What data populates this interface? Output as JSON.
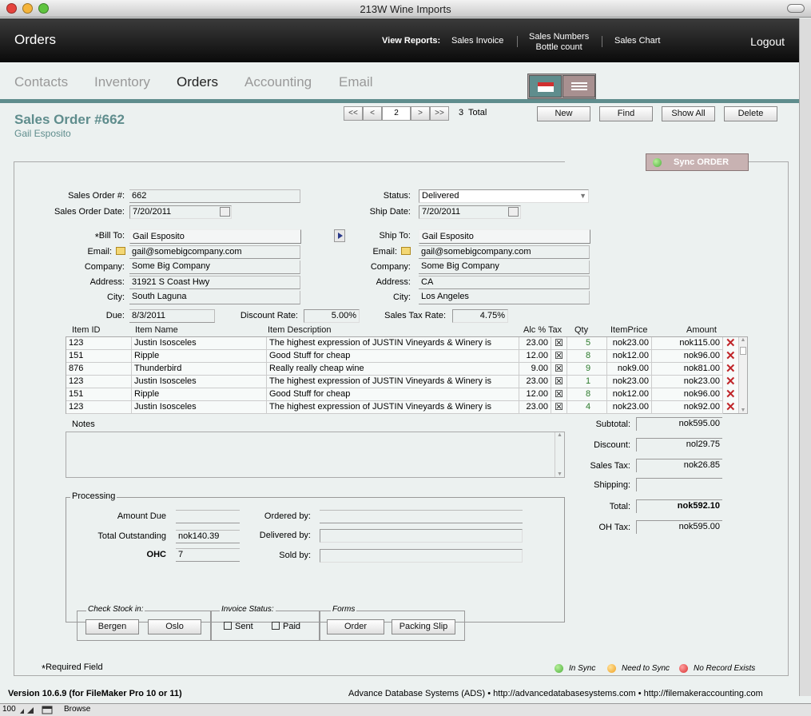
{
  "window": {
    "title": "213W Wine Imports"
  },
  "header": {
    "title": "Orders",
    "view_reports_label": "View Reports:",
    "reports": [
      "Sales Invoice",
      "Sales Numbers",
      "Bottle count",
      "Sales Chart"
    ],
    "logout": "Logout"
  },
  "nav": {
    "tabs": [
      "Contacts",
      "Inventory",
      "Orders",
      "Accounting",
      "Email"
    ],
    "active": "Orders"
  },
  "record": {
    "title": "Sales Order #662",
    "subtitle": "Gail Esposito",
    "current": "2",
    "total": "3  Total",
    "nav_first": "<<",
    "nav_prev": "<",
    "nav_next": ">",
    "nav_last": ">>"
  },
  "actions": {
    "new": "New",
    "find": "Find",
    "show_all": "Show All",
    "delete": "Delete",
    "sync": "Sync ORDER"
  },
  "form": {
    "sales_order_no_label": "Sales Order #:",
    "sales_order_no": "662",
    "sales_order_date_label": "Sales Order Date:",
    "sales_order_date": "7/20/2011",
    "status_label": "Status:",
    "status": "Delivered",
    "ship_date_label": "Ship Date:",
    "ship_date": "7/20/2011",
    "bill_to_label": "Bill To:",
    "bill_to_required_mark": "*",
    "bill_to": "Gail Esposito",
    "bill_email_label": "Email:",
    "bill_email": "gail@somebigcompany.com",
    "bill_company_label": "Company:",
    "bill_company": "Some Big Company",
    "bill_address_label": "Address:",
    "bill_address": "31921 S Coast Hwy",
    "bill_city_label": "City:",
    "bill_city": "South Laguna",
    "ship_to_label": "Ship To:",
    "ship_to": "Gail Esposito",
    "ship_email_label": "Email:",
    "ship_email": "gail@somebigcompany.com",
    "ship_company_label": "Company:",
    "ship_company": "Some Big Company",
    "ship_address_label": "Address:",
    "ship_address": "CA",
    "ship_city_label": "City:",
    "ship_city": "Los Angeles",
    "due_label": "Due:",
    "due": "8/3/2011",
    "discount_rate_label": "Discount Rate:",
    "discount_rate": "5.00%",
    "sales_tax_rate_label": "Sales Tax Rate:",
    "sales_tax_rate": "4.75%"
  },
  "line_items": {
    "headers": [
      "Item ID",
      "Item Name",
      "Item Description",
      "Alc %",
      "Tax",
      "Qty",
      "ItemPrice",
      "Amount"
    ],
    "rows": [
      {
        "id": "123",
        "name": "Justin Isosceles",
        "desc": "The highest expression of JUSTIN Vineyards & Winery is",
        "alc": "23.00",
        "tax": "☒",
        "qty": "5",
        "price": "nok23.00",
        "amount": "nok115.00"
      },
      {
        "id": "151",
        "name": "Ripple",
        "desc": "Good Stuff for cheap",
        "alc": "12.00",
        "tax": "☒",
        "qty": "8",
        "price": "nok12.00",
        "amount": "nok96.00"
      },
      {
        "id": "876",
        "name": "Thunderbird",
        "desc": "Really really cheap wine",
        "alc": "9.00",
        "tax": "☒",
        "qty": "9",
        "price": "nok9.00",
        "amount": "nok81.00"
      },
      {
        "id": "123",
        "name": "Justin Isosceles",
        "desc": "The highest expression of JUSTIN Vineyards & Winery is",
        "alc": "23.00",
        "tax": "☒",
        "qty": "1",
        "price": "nok23.00",
        "amount": "nok23.00"
      },
      {
        "id": "151",
        "name": "Ripple",
        "desc": "Good Stuff for cheap",
        "alc": "12.00",
        "tax": "☒",
        "qty": "8",
        "price": "nok12.00",
        "amount": "nok96.00"
      },
      {
        "id": "123",
        "name": "Justin Isosceles",
        "desc": "The highest expression of JUSTIN Vineyards & Winery is",
        "alc": "23.00",
        "tax": "☒",
        "qty": "4",
        "price": "nok23.00",
        "amount": "nok92.00"
      }
    ]
  },
  "notes": {
    "label": "Notes",
    "value": ""
  },
  "summary": {
    "subtotal_label": "Subtotal:",
    "subtotal": "nok595.00",
    "discount_label": "Discount:",
    "discount": "nol29.75",
    "sales_tax_label": "Sales Tax:",
    "sales_tax": "nok26.85",
    "shipping_label": "Shipping:",
    "shipping": "",
    "total_label": "Total:",
    "total": "nok592.10",
    "oh_tax_label": "OH Tax:",
    "oh_tax": "nok595.00"
  },
  "processing": {
    "label": "Processing",
    "amount_due_label": "Amount Due",
    "amount_due": "",
    "total_outstanding_label": "Total Outstanding",
    "total_outstanding": "nok140.39",
    "ohc_label": "OHC",
    "ohc": "7",
    "ordered_by_label": "Ordered by:",
    "ordered_by": "",
    "delivered_by_label": "Delivered by:",
    "delivered_by": "",
    "sold_by_label": "Sold by:",
    "sold_by": "",
    "check_stock_label": "Check Stock in:",
    "bergen": "Bergen",
    "oslo": "Oslo",
    "invoice_status_label": "Invoice Status:",
    "sent": "Sent",
    "paid": "Paid",
    "forms_label": "Forms",
    "order": "Order",
    "packing_slip": "Packing Slip"
  },
  "legend": {
    "required_mark": "*",
    "required": "Required Field",
    "in_sync": "In Sync",
    "need_sync": "Need to Sync",
    "no_record": "No Record Exists"
  },
  "footer": {
    "version": "Version 10.6.9 (for FileMaker Pro 10 or 11)",
    "credits": "Advance Database Systems (ADS) • http://advancedatabasesystems.com • http://filemakeraccounting.com",
    "zoom": "100",
    "mode": "Browse"
  },
  "colors": {
    "accent": "#5f8d8d",
    "delete": "#c0262a",
    "sync_panel": "#c8b2b2",
    "led_green": "#4caf3c",
    "led_orange": "#f0a020",
    "led_red": "#d83030"
  }
}
